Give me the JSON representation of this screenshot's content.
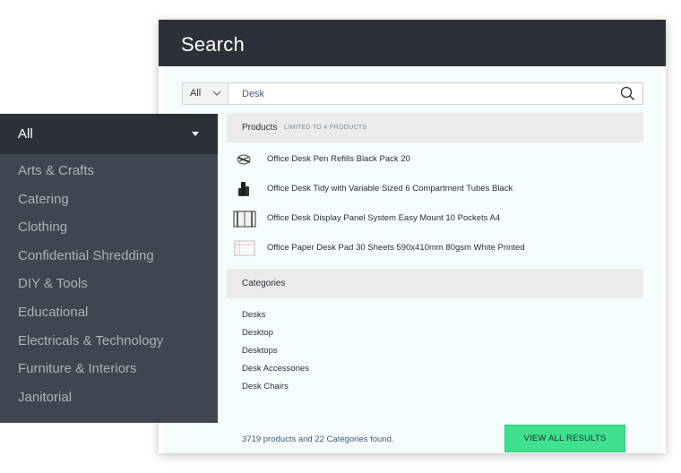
{
  "search": {
    "title": "Search",
    "scope": "All",
    "query": "Desk"
  },
  "products": {
    "heading": "Products",
    "note": "LIMITED TO 4 PRODUCTS",
    "items": [
      {
        "name": "Office Desk Pen Refills Black Pack 20",
        "icon": "pen-refills-thumbnail"
      },
      {
        "name": "Office Desk Tidy with Variable Sized 6 Compartment Tubes Black",
        "icon": "desk-tidy-thumbnail"
      },
      {
        "name": "Office Desk Display Panel System Easy Mount 10 Pockets A4",
        "icon": "display-panel-thumbnail"
      },
      {
        "name": "Office Paper Desk Pad 30 Sheets 590x410mm 80gsm White Printed",
        "icon": "desk-pad-thumbnail"
      }
    ]
  },
  "categories": {
    "heading": "Categories",
    "items": [
      "Desks",
      "Desktop",
      "Desktops",
      "Desk Accessories",
      "Desk Chairs"
    ]
  },
  "summary": "3719 products and 22 Categories found.",
  "view_all_label": "VIEW ALL RESULTS",
  "menu": {
    "title": "All",
    "items": [
      "Arts & Crafts",
      "Catering",
      "Clothing",
      "Confidential Shredding",
      "DIY & Tools",
      "Educational",
      "Electricals & Technology",
      "Furniture & Interiors",
      "Janitorial"
    ]
  },
  "colors": {
    "header_bg": "#2c3139",
    "menu_bg": "#3f4651",
    "results_bg": "#f4fcfd",
    "button_green": "#3fe08e"
  }
}
